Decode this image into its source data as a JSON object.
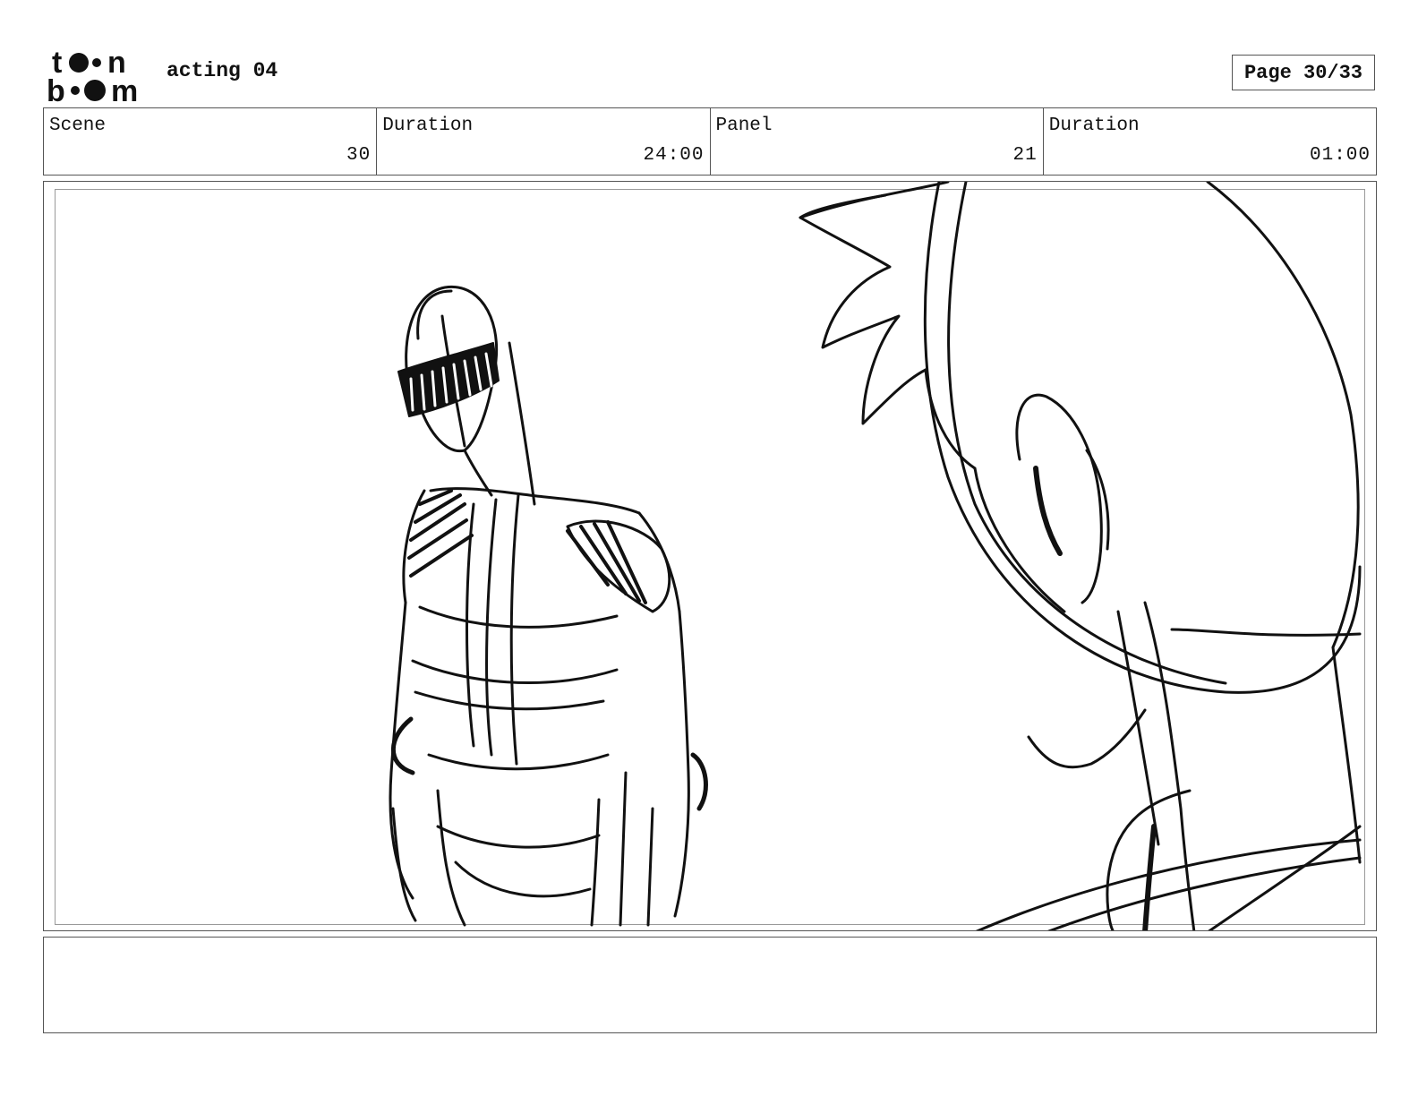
{
  "header": {
    "logo_text": [
      "t",
      "n",
      "b",
      "m"
    ],
    "title": "acting 04",
    "page_label": "Page 30/33"
  },
  "info": {
    "scene": {
      "label": "Scene",
      "value": "30"
    },
    "scene_duration": {
      "label": "Duration",
      "value": "24:00"
    },
    "panel": {
      "label": "Panel",
      "value": "21"
    },
    "panel_duration": {
      "label": "Duration",
      "value": "01:00"
    }
  },
  "notes": {
    "text": ""
  },
  "colors": {
    "ink": "#111111",
    "border": "#555555",
    "inner_border": "#999999"
  }
}
